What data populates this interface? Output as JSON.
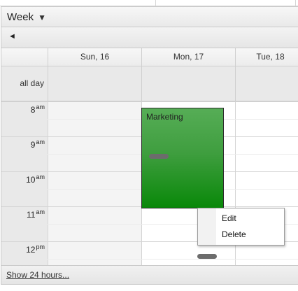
{
  "toolbar": {
    "view_label": "Week",
    "view_arrow": "▼"
  },
  "nav": {
    "prev_glyph": "◄"
  },
  "days": [
    {
      "label": "Sun, 16"
    },
    {
      "label": "Mon, 17"
    },
    {
      "label": "Tue, 18"
    }
  ],
  "allday": {
    "label": "all day"
  },
  "hours": [
    {
      "num": "8",
      "suffix": "am"
    },
    {
      "num": "9",
      "suffix": "am"
    },
    {
      "num": "10",
      "suffix": "am"
    },
    {
      "num": "11",
      "suffix": "am"
    },
    {
      "num": "12",
      "suffix": "pm"
    }
  ],
  "event": {
    "title": "Marketing",
    "color": "#098809"
  },
  "context_menu": {
    "items": [
      {
        "label": "Edit"
      },
      {
        "label": "Delete"
      }
    ]
  },
  "footer": {
    "show_hours_link": "Show 24 hours..."
  }
}
